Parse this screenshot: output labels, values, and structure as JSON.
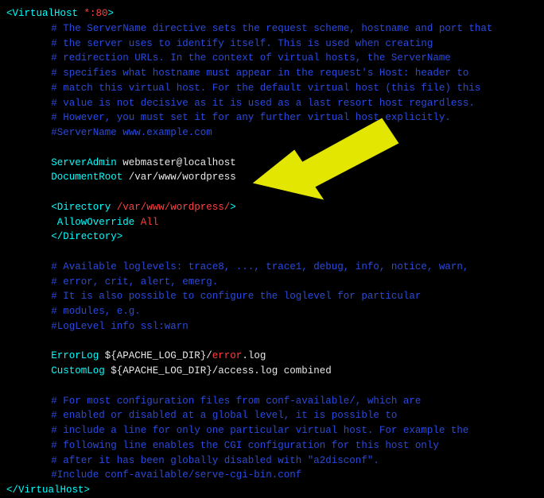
{
  "vhost": {
    "open1": "<VirtualHost",
    "port": " *:80",
    "open2": ">",
    "close": "</VirtualHost>"
  },
  "comments": {
    "top": [
      "# The ServerName directive sets the request scheme, hostname and port that",
      "# the server uses to identify itself. This is used when creating",
      "# redirection URLs. In the context of virtual hosts, the ServerName",
      "# specifies what hostname must appear in the request's Host: header to",
      "# match this virtual host. For the default virtual host (this file) this",
      "# value is not decisive as it is used as a last resort host regardless.",
      "# However, you must set it for any further virtual host explicitly.",
      "#ServerName www.example.com"
    ],
    "log": [
      "# Available loglevels: trace8, ..., trace1, debug, info, notice, warn,",
      "# error, crit, alert, emerg.",
      "# It is also possible to configure the loglevel for particular",
      "# modules, e.g.",
      "#LogLevel info ssl:warn"
    ],
    "bottom": [
      "# For most configuration files from conf-available/, which are",
      "# enabled or disabled at a global level, it is possible to",
      "# include a line for only one particular virtual host. For example the",
      "# following line enables the CGI configuration for this host only",
      "# after it has been globally disabled with \"a2disconf\".",
      "#Include conf-available/serve-cgi-bin.conf"
    ]
  },
  "directives": {
    "serverAdmin": {
      "key": "ServerAdmin",
      "value": " webmaster@localhost"
    },
    "docRoot": {
      "key": "DocumentRoot",
      "value": " /var/www/wordpress"
    },
    "directory": {
      "open1": "<Directory",
      "path": " /var/www/wordpress/",
      "open2": ">",
      "allowKey": "AllowOverride",
      "allowVal": " All",
      "close": "</Directory>"
    },
    "errorLog": {
      "key": "ErrorLog",
      "pre": " ${APACHE_LOG_DIR}/",
      "name": "error",
      "suf": ".log"
    },
    "customLog": {
      "key": "CustomLog",
      "value": " ${APACHE_LOG_DIR}/access.log combined"
    }
  },
  "arrow": {
    "color": "#e2e600"
  }
}
